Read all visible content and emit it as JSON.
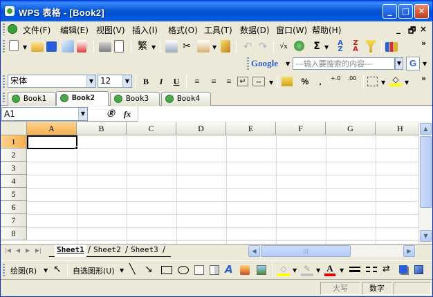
{
  "window": {
    "title": "WPS 表格 - [Book2]",
    "controls": {
      "minimize": "_",
      "maximize": "□",
      "close": "✕"
    }
  },
  "menu": {
    "items": [
      "文件(F)",
      "编辑(E)",
      "视图(V)",
      "插入(I)",
      "格式(O)",
      "工具(T)",
      "数据(D)",
      "窗口(W)",
      "帮助(H)"
    ],
    "mdi_controls": {
      "minimize": "_",
      "restore": "🗗",
      "close": "×"
    }
  },
  "standard_toolbar": {
    "icons": [
      "new-icon",
      "open-icon",
      "save-icon",
      "mail-icon",
      "export-pdf-icon",
      "print-icon",
      "print-preview-icon",
      "traditional-chinese-icon",
      "cut-icon",
      "copy-icon",
      "paste-icon",
      "format-painter-icon",
      "undo-icon",
      "redo-icon",
      "insert-function-icon",
      "hyperlink-icon",
      "autosum-icon",
      "sort-ascending-icon",
      "sort-descending-icon",
      "filter-icon",
      "chart-icon"
    ],
    "traditional_label": "繁",
    "sigma_label": "Σ",
    "more": "»"
  },
  "google_search": {
    "logo": "Google",
    "placeholder": "---输入要搜索的内容---",
    "button": "G"
  },
  "format_toolbar": {
    "font_name": "宋体",
    "font_size": "12",
    "bold": "B",
    "italic": "I",
    "underline": "U",
    "percent": "%",
    "comma": ",",
    "increase_decimal": "+.0",
    "decrease_decimal": ".00",
    "more": "»"
  },
  "book_tabs": [
    {
      "label": "Book1",
      "active": false
    },
    {
      "label": "Book2",
      "active": true
    },
    {
      "label": "Book3",
      "active": false
    },
    {
      "label": "Book4",
      "active": false
    }
  ],
  "formula_bar": {
    "name_box": "A1",
    "fx_label": "fx",
    "value": ""
  },
  "grid": {
    "columns": [
      "A",
      "B",
      "C",
      "D",
      "E",
      "F",
      "G",
      "H"
    ],
    "rows": [
      "1",
      "2",
      "3",
      "4",
      "5",
      "6",
      "7",
      "8"
    ],
    "active_cell": "A1",
    "selected_column": "A",
    "selected_row": "1"
  },
  "sheet_tabs": [
    {
      "label": "Sheet1",
      "active": true
    },
    {
      "label": "Sheet2",
      "active": false
    },
    {
      "label": "Sheet3",
      "active": false
    }
  ],
  "drawing_toolbar": {
    "draw_label": "绘图(R)",
    "autoshapes_label": "自选图形(U)"
  },
  "status_bar": {
    "caps": "大写",
    "num": "数字"
  },
  "colors": {
    "titlebar": "#0a5ad8",
    "selection_header": "#f4b050",
    "chrome": "#ece9d8",
    "font_color_underline": "#e00000",
    "highlight_color": "#ffff00"
  }
}
